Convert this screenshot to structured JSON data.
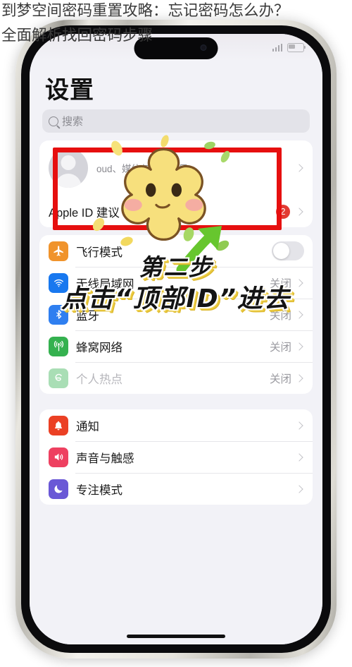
{
  "article": {
    "title": "到梦空间密码重置攻略：忘记密码怎么办？\n全面解析找回密码步骤"
  },
  "phone": {
    "status_bar": {
      "signal_icon": "signal-bars-icon",
      "battery_icon": "battery-icon"
    },
    "home_indicator": "home-indicator"
  },
  "settings": {
    "page_title": "设置",
    "search": {
      "placeholder": "搜索",
      "icon": "search-icon"
    },
    "apple_id": {
      "name": "",
      "subtitle": "oud、媒体与购买项目",
      "avatar_icon": "person-avatar-icon",
      "chevron": "chevron-right-icon"
    },
    "apple_id_suggestion": {
      "label": "Apple ID 建议",
      "badge": "2",
      "badge_color": "#e23b33",
      "chevron": "chevron-right-icon"
    },
    "group_network": [
      {
        "label": "飞行模式",
        "icon": "airplane-icon",
        "icon_color": "#f0932b",
        "control": "toggle",
        "value": "",
        "enabled": true
      },
      {
        "label": "无线局域网",
        "icon": "wifi-icon",
        "icon_color": "#1878ef",
        "control": "value",
        "value": "关闭",
        "enabled": true
      },
      {
        "label": "蓝牙",
        "icon": "bluetooth-icon",
        "icon_color": "#2f7ff0",
        "control": "value",
        "value": "关闭",
        "enabled": true
      },
      {
        "label": "蜂窝网络",
        "icon": "cellular-icon",
        "icon_color": "#34b14f",
        "control": "value",
        "value": "关闭",
        "enabled": true
      },
      {
        "label": "个人热点",
        "icon": "hotspot-icon",
        "icon_color": "#34b14f",
        "control": "value",
        "value": "关闭",
        "enabled": false
      }
    ],
    "group_system": [
      {
        "label": "通知",
        "icon": "bell-icon",
        "icon_color": "#eb4024",
        "control": "chevron",
        "value": ""
      },
      {
        "label": "声音与触感",
        "icon": "speaker-icon",
        "icon_color": "#ee4060",
        "control": "chevron",
        "value": ""
      },
      {
        "label": "专注模式",
        "icon": "moon-icon",
        "icon_color": "#6a58d6",
        "control": "chevron",
        "value": ""
      }
    ]
  },
  "annotation": {
    "highlight_color": "#e60f0f",
    "step_line1": "第二步",
    "step_line2": "点击“顶部ID”进去",
    "arrow_icon": "arrow-up-right-icon",
    "sticker_icon": "yellow-flower-sticker"
  }
}
